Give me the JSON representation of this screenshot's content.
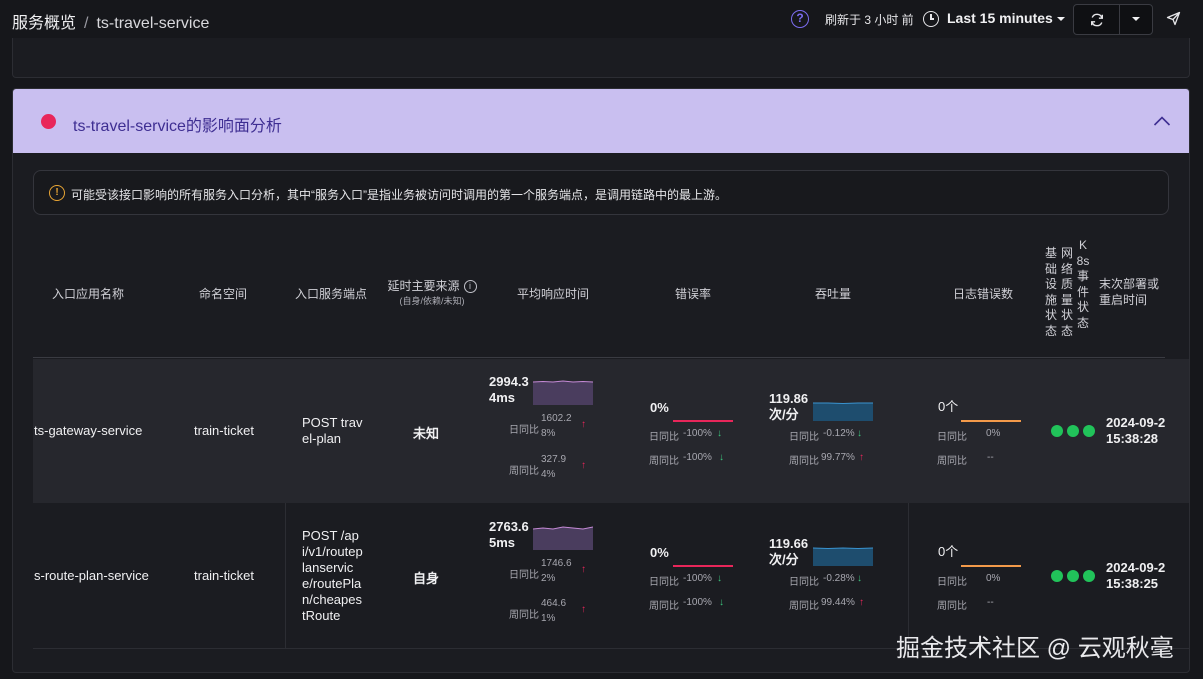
{
  "breadcrumb": {
    "root": "服务概览",
    "separator": "/",
    "service": "ts-travel-service"
  },
  "header": {
    "refresh_text": "刷新于 3 小时 前",
    "time_range": "Last 15 minutes"
  },
  "panel": {
    "title": "ts-travel-service的影响面分析",
    "notice": "可能受该接口影响的所有服务入口分析，其中“服务入口”是指业务被访问时调用的第一个服务端点，是调用链路中的最上游。"
  },
  "table": {
    "columns": {
      "entry_app": "入口应用名称",
      "namespace": "命名空间",
      "endpoint": "入口服务端点",
      "latency_source": "延时主要来源",
      "latency_source_sub": "(自身/依赖/未知)",
      "avg_response": "平均响应时间",
      "error_rate": "错误率",
      "throughput": "吞吐量",
      "log_errors": "日志错误数",
      "infra_status": "基础设施状态",
      "network_status": "网络质量状态",
      "k8s_status": "K8s事件状态",
      "last_deploy": "末次部署或重启时间"
    },
    "rows": [
      {
        "entry_app": "ts-gateway-service",
        "namespace": "train-ticket",
        "endpoint": "POST travel-plan",
        "latency_source": "未知",
        "avg_response": {
          "value": "2994.34ms",
          "day_label": "日同比",
          "day_value": "1602.28%",
          "day_arrow": "↑",
          "week_label": "周同比",
          "week_value": "327.94%",
          "week_arrow": "↑"
        },
        "error_rate": {
          "value": "0%",
          "day_label": "日同比",
          "day_value": "-100%",
          "day_arrow": "↓",
          "week_label": "周同比",
          "week_value": "-100%",
          "week_arrow": "↓"
        },
        "throughput": {
          "value": "119.86次/分",
          "day_label": "日同比",
          "day_value": "-0.12%",
          "day_arrow": "↓",
          "week_label": "周同比",
          "week_value": "99.77%",
          "week_arrow": "↑"
        },
        "log_errors": {
          "value": "0个",
          "day_label": "日同比",
          "day_value": "0%",
          "week_label": "周同比",
          "week_value": "--"
        },
        "last_deploy_date": "2024-09-2",
        "last_deploy_time": "15:38:28"
      },
      {
        "entry_app": "s-route-plan-service",
        "namespace": "train-ticket",
        "endpoint": "POST /api/v1/routeplanservice/routePlan/cheapestRoute",
        "latency_source": "自身",
        "avg_response": {
          "value": "2763.65ms",
          "day_label": "日同比",
          "day_value": "1746.62%",
          "day_arrow": "↑",
          "week_label": "周同比",
          "week_value": "464.61%",
          "week_arrow": "↑"
        },
        "error_rate": {
          "value": "0%",
          "day_label": "日同比",
          "day_value": "-100%",
          "day_arrow": "↓",
          "week_label": "周同比",
          "week_value": "-100%",
          "week_arrow": "↓"
        },
        "throughput": {
          "value": "119.66次/分",
          "day_label": "日同比",
          "day_value": "-0.28%",
          "day_arrow": "↓",
          "week_label": "周同比",
          "week_value": "99.44%",
          "week_arrow": "↑"
        },
        "log_errors": {
          "value": "0个",
          "day_label": "日同比",
          "day_value": "0%",
          "week_label": "周同比",
          "week_value": "--"
        },
        "last_deploy_date": "2024-09-2",
        "last_deploy_time": "15:38:25"
      }
    ]
  },
  "colors": {
    "accent": "#7b6cf0",
    "panel_header": "#c9bff0",
    "status_ok": "#21c35a",
    "alert_red": "#e8265a",
    "trend_up": "#e8265a",
    "trend_down": "#3cc47c"
  },
  "watermark": "掘金技术社区 @ 云观秋毫"
}
